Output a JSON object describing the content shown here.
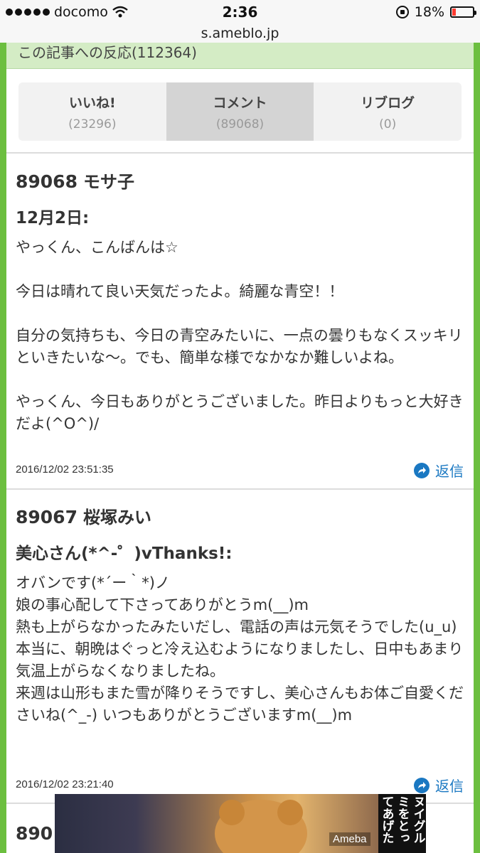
{
  "status_bar": {
    "carrier": "docomo",
    "time": "2:36",
    "battery_percent": "18%",
    "battery_level": 0.18,
    "icons": [
      "signal-dots-icon",
      "wifi-icon",
      "rotation-lock-icon",
      "battery-icon"
    ]
  },
  "url_bar": {
    "url": "s.ameblo.jp"
  },
  "reactions": {
    "header": "この記事への反応(112364)",
    "tabs": [
      {
        "label": "いいね!",
        "count": "(23296)"
      },
      {
        "label": "コメント",
        "count": "(89068)"
      },
      {
        "label": "リブログ",
        "count": "(0)"
      }
    ],
    "active_tab": "コメント"
  },
  "comments": [
    {
      "number": "89068",
      "author": "モサ子",
      "title": "12月2日:",
      "body": "やっくん、こんばんは☆\n\n今日は晴れて良い天気だったよ。綺麗な青空！！\n\n自分の気持ちも、今日の青空みたいに、一点の曇りもなくスッキリといきたいな～。でも、簡単な様でなかなか難しいよね。\n\nやっくん、今日もありがとうございました。昨日よりもっと大好きだよ(^O^)/",
      "date": "2016/12/02 23:51:35",
      "reply_label": "返信"
    },
    {
      "number": "89067",
      "author": "桜塚みい",
      "title": "美心さん(*^-゜)vThanks!:",
      "body": "オバンです(*´ー｀*)ノ\n娘の事心配して下さってありがとうm(__)m\n熱も上がらなかったみたいだし、電話の声は元気そうでした(u_u)\n本当に、朝晩はぐっと冷え込むようになりましたし、日中もあまり気温上がらなくなりましたね。\n来週は山形もまた雪が降りそうですし、美心さんもお体ご自愛くださいね(^_-) いつもありがとうございますm(__)m",
      "date": "2016/12/02 23:21:40",
      "reply_label": "返信"
    }
  ],
  "partial_comment_number": "890",
  "ad": {
    "logo": "Ameba",
    "text_columns": [
      "ヌイグル",
      "ミをとっ",
      "てあげた"
    ]
  },
  "colors": {
    "frame_green": "#6cbf3f",
    "header_green": "#d4ecc5",
    "link_blue": "#1a78c2",
    "battery_red": "#ff3b30"
  }
}
